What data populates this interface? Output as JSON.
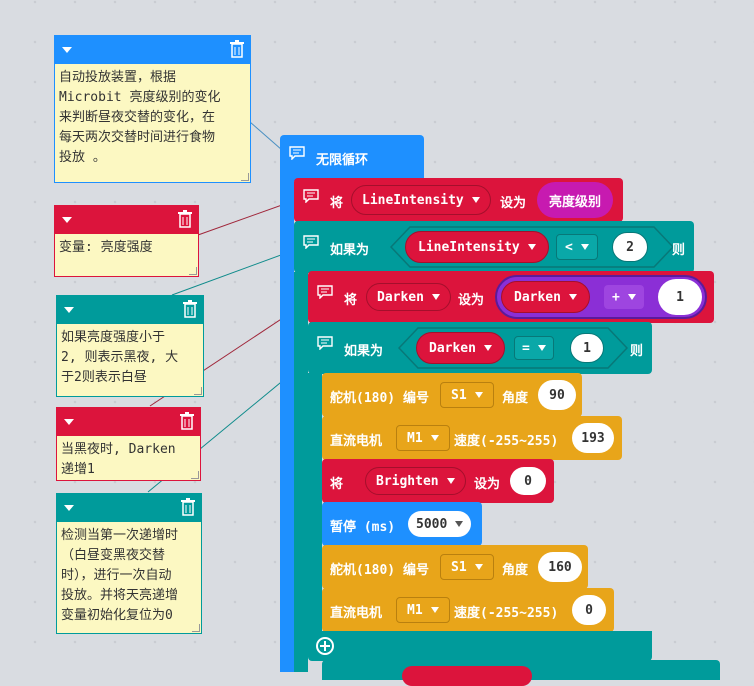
{
  "colors": {
    "loop": "#1e90ff",
    "var": "#dc143c",
    "logic": "#009b9b",
    "servo": "#e8a51a",
    "numpill": "#ffffff",
    "note": "#fcf8c2",
    "darken_plus": "#8b2fd6",
    "bright_level": "#c71ab0"
  },
  "notes": [
    {
      "text": "自动投放装置，根据\nMicrobit 亮度级别的变化\n来判断昼夜交替的变化，在\n每天两次交替时间进行食物\n投放 。"
    },
    {
      "text": "变量: 亮度强度"
    },
    {
      "text": "如果亮度强度小于\n2, 则表示黑夜, 大\n于2则表示白昼"
    },
    {
      "text": "当黑夜时, Darken\n递增1"
    },
    {
      "text": "检测当第一次递增时\n（白昼变黑夜交替\n时），进行一次自动\n投放。并将天亮递增\n变量初始化复位为0"
    }
  ],
  "loop": {
    "label": "无限循环"
  },
  "set1": {
    "label_set": "将",
    "var": "LineIntensity",
    "label_to": "设为",
    "value": "亮度级别"
  },
  "if1": {
    "label_if": "如果为",
    "var": "LineIntensity",
    "op": "<",
    "num": "2",
    "label_then": "则"
  },
  "set2": {
    "label_set": "将",
    "var": "Darken",
    "label_to": "设为",
    "var2": "Darken",
    "op": "+",
    "num": "1"
  },
  "if2": {
    "label_if": "如果为",
    "var": "Darken",
    "op": "=",
    "num": "1",
    "label_then": "则"
  },
  "servo1": {
    "label": "舵机(180) 编号",
    "port": "S1",
    "label_angle": "角度",
    "angle": "90"
  },
  "motor1": {
    "label": "直流电机",
    "port": "M1",
    "label_speed": "速度(-255~255)",
    "speed": "193"
  },
  "set3": {
    "label_set": "将",
    "var": "Brighten",
    "label_to": "设为",
    "value": "0"
  },
  "pause": {
    "label": "暂停 (ms)",
    "value": "5000"
  },
  "servo2": {
    "label": "舵机(180) 编号",
    "port": "S1",
    "label_angle": "角度",
    "angle": "160"
  },
  "motor2": {
    "label": "直流电机",
    "port": "M1",
    "label_speed": "速度(-255~255)",
    "speed": "0"
  }
}
